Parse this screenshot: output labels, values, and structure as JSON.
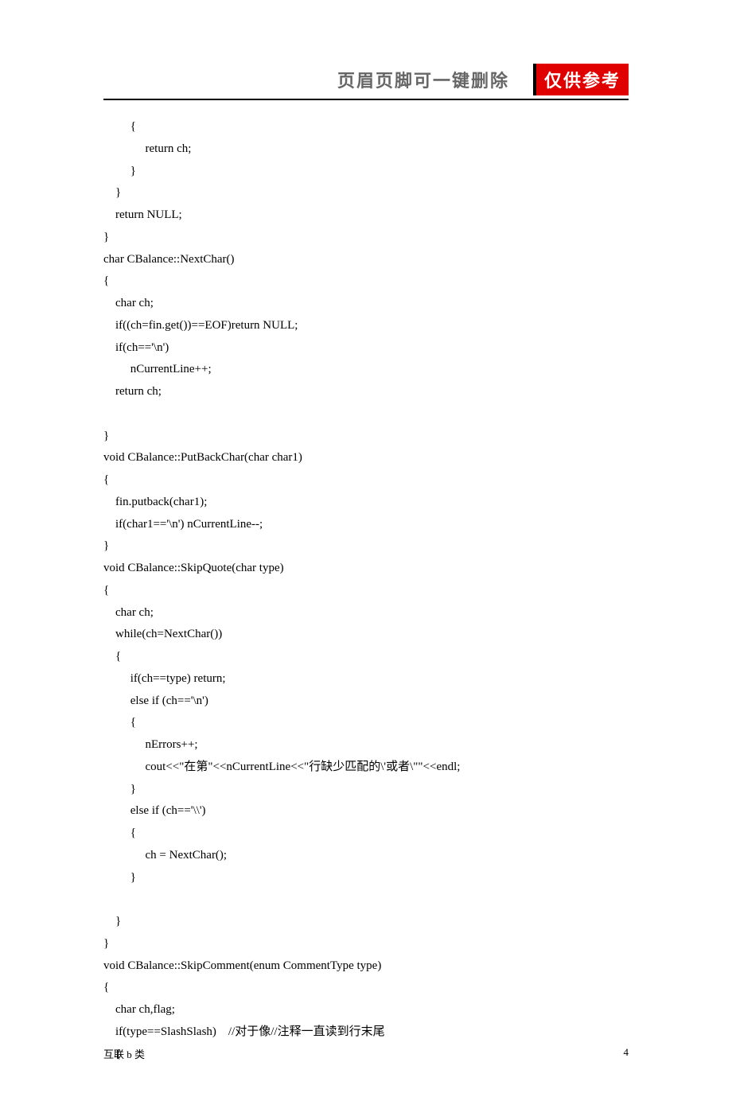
{
  "header": {
    "title": "页眉页脚可一键删除",
    "stamp": "仅供参考"
  },
  "code": "         {\n              return ch;\n         }\n    }\n    return NULL;\n}\nchar CBalance::NextChar()\n{\n    char ch;\n    if((ch=fin.get())==EOF)return NULL;\n    if(ch=='\\n')\n         nCurrentLine++;\n    return ch;\n\n}\nvoid CBalance::PutBackChar(char char1)\n{\n    fin.putback(char1);\n    if(char1=='\\n') nCurrentLine--;\n}\nvoid CBalance::SkipQuote(char type)\n{\n    char ch;\n    while(ch=NextChar())\n    {\n         if(ch==type) return;\n         else if (ch=='\\n')\n         {\n              nErrors++;\n              cout<<\"在第\"<<nCurrentLine<<\"行缺少匹配的\\'或者\\\"\"<<endl;\n         }\n         else if (ch=='\\\\')\n         {\n              ch = NextChar();\n         }\n\n    }\n}\nvoid CBalance::SkipComment(enum CommentType type)\n{\n    char ch,flag;\n    if(type==SlashSlash)    //对于像//注释一直读到行末尾\n    {",
  "footer": {
    "left": "互联 b 类",
    "pageNumber": "4"
  }
}
